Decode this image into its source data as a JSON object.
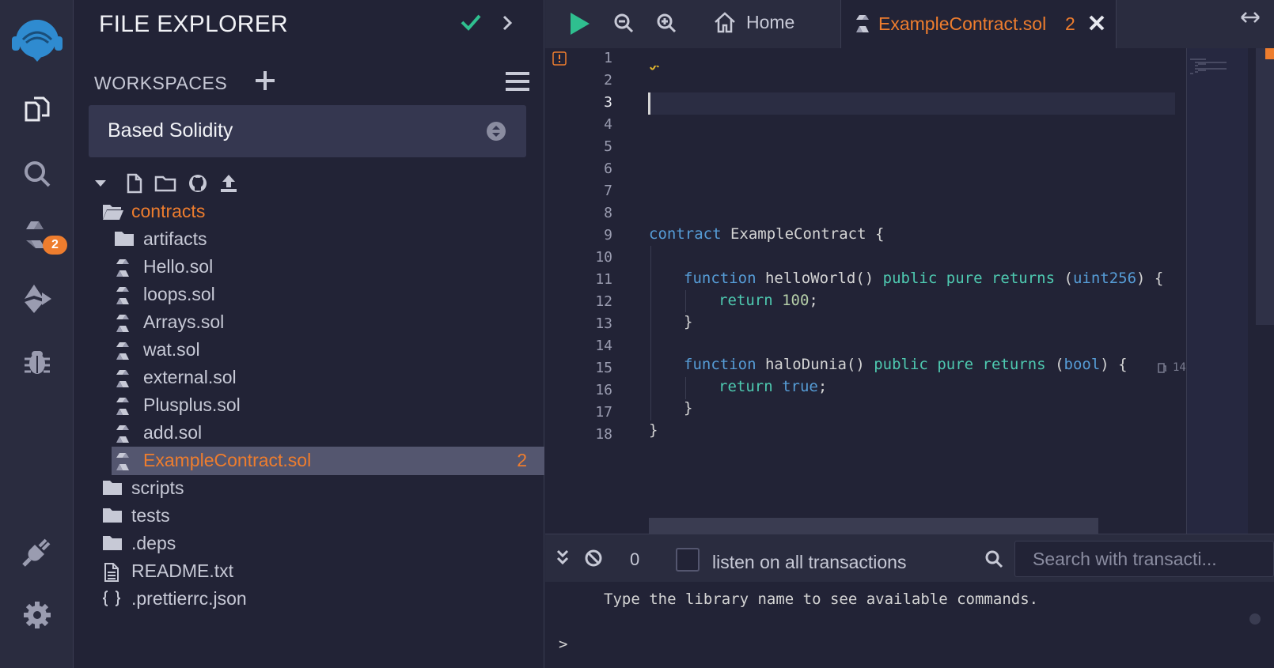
{
  "app": {
    "accent": "#ee7d2e",
    "background": "#222336"
  },
  "iconbar": {
    "items": [
      {
        "icon": "remix-logo-icon"
      },
      {
        "icon": "file-explorer-icon"
      },
      {
        "icon": "search-icon"
      },
      {
        "icon": "solidity-compiler-icon",
        "badge": "2"
      },
      {
        "icon": "deploy-run-icon"
      },
      {
        "icon": "debugger-icon"
      },
      {
        "icon": "plugin-manager-icon"
      },
      {
        "icon": "settings-icon"
      }
    ]
  },
  "explorer": {
    "title": "FILE EXPLORER",
    "workspaces_label": "WORKSPACES",
    "workspace_selected": "Based Solidity",
    "tree": [
      {
        "label": "contracts",
        "type": "folder-open",
        "level": 0,
        "highlight": true
      },
      {
        "label": "artifacts",
        "type": "folder",
        "level": 1
      },
      {
        "label": "Hello.sol",
        "type": "sol",
        "level": 1
      },
      {
        "label": "loops.sol",
        "type": "sol",
        "level": 1
      },
      {
        "label": "Arrays.sol",
        "type": "sol",
        "level": 1
      },
      {
        "label": "wat.sol",
        "type": "sol",
        "level": 1
      },
      {
        "label": "external.sol",
        "type": "sol",
        "level": 1
      },
      {
        "label": "Plusplus.sol",
        "type": "sol",
        "level": 1
      },
      {
        "label": "add.sol",
        "type": "sol",
        "level": 1
      },
      {
        "label": "ExampleContract.sol",
        "type": "sol",
        "level": 1,
        "selected": true,
        "count": "2"
      },
      {
        "label": "scripts",
        "type": "folder",
        "level": 0
      },
      {
        "label": "tests",
        "type": "folder",
        "level": 0
      },
      {
        "label": ".deps",
        "type": "folder",
        "level": 0
      },
      {
        "label": "README.txt",
        "type": "file",
        "level": 0
      },
      {
        "label": ".prettierrc.json",
        "type": "json",
        "level": 0
      }
    ]
  },
  "editor": {
    "home_tab": "Home",
    "active_tab": "ExampleContract.sol",
    "active_tab_count": "2",
    "line_numbers": [
      "1",
      "2",
      "3",
      "4",
      "5",
      "6",
      "7",
      "8",
      "9",
      "10",
      "11",
      "12",
      "13",
      "14",
      "15",
      "16",
      "17",
      "18"
    ],
    "current_line": "3",
    "code": {
      "l9_kw": "contract",
      "l9_rest": " ExampleContract {",
      "l11_kw": "function",
      "l11_name": " helloWorld() ",
      "l11_mod1": "public",
      "l11_mod2": "pure",
      "l11_ret": "returns",
      "l11_open": " (",
      "l11_type": "uint256",
      "l11_close": ") {",
      "l12_kw": "return",
      "l12_num": "100",
      "l12_end": ";",
      "l13": "}",
      "l15_kw": "function",
      "l15_name": " haloDunia() ",
      "l15_mod1": "public",
      "l15_mod2": "pure",
      "l15_ret": "returns",
      "l15_open": " (",
      "l15_type": "bool",
      "l15_close": ") {",
      "l16_kw": "return",
      "l16_val": "true",
      "l16_end": ";",
      "l17": "}",
      "l18": "}"
    },
    "gas_hint": "14"
  },
  "terminal": {
    "pending_count": "0",
    "listen_label": "listen on all transactions",
    "search_placeholder": "Search with transacti...",
    "message": "Type the library name to see available commands.",
    "prompt": ">"
  }
}
